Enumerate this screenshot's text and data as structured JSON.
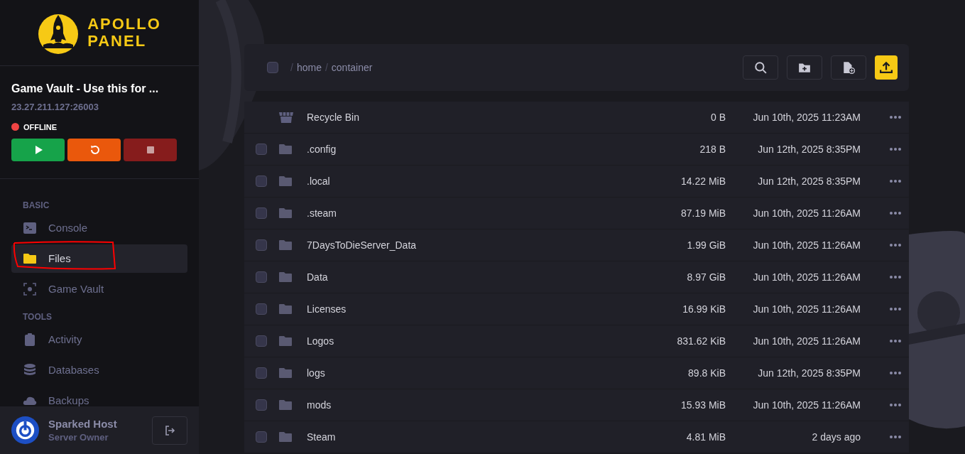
{
  "brand": {
    "line_1": "APOLLO",
    "line_2": "PANEL"
  },
  "server": {
    "name": "Game Vault - Use this for ...",
    "address": "23.27.211.127:26003",
    "status": "OFFLINE",
    "online": false
  },
  "power_buttons": [
    {
      "kind": "start"
    },
    {
      "kind": "restart"
    },
    {
      "kind": "stop"
    }
  ],
  "nav_sections": [
    {
      "title": "BASIC",
      "items": [
        {
          "label": "Console",
          "kind": "terminal",
          "selected": false,
          "annotated": false
        },
        {
          "label": "Files",
          "kind": "folder",
          "selected": true,
          "annotated": true
        },
        {
          "label": "Game Vault",
          "kind": "focus",
          "selected": false,
          "annotated": false
        }
      ]
    },
    {
      "title": "TOOLS",
      "items": [
        {
          "label": "Activity",
          "kind": "clipboard",
          "selected": false,
          "annotated": false
        },
        {
          "label": "Databases",
          "kind": "database",
          "selected": false,
          "annotated": false
        },
        {
          "label": "Backups",
          "kind": "cloud",
          "selected": false,
          "annotated": false
        }
      ]
    }
  ],
  "user": {
    "name": "Sparked Host",
    "role": "Server Owner"
  },
  "select_all_checked": false,
  "breadcrumb": [
    {
      "separator": "/",
      "label": "home"
    },
    {
      "separator": "/",
      "label": "container"
    }
  ],
  "toolbar": [
    {
      "kind": "search"
    },
    {
      "kind": "new-folder"
    },
    {
      "kind": "new-file"
    },
    {
      "kind": "upload"
    }
  ],
  "files": [
    {
      "kind": "recycle",
      "name": "Recycle Bin",
      "size": "0 B",
      "modified": "Jun 10th, 2025 11:23AM"
    },
    {
      "kind": "folder",
      "name": ".config",
      "size": "218 B",
      "modified": "Jun 12th, 2025 8:35PM",
      "checked": false
    },
    {
      "kind": "folder",
      "name": ".local",
      "size": "14.22 MiB",
      "modified": "Jun 12th, 2025 8:35PM",
      "checked": false
    },
    {
      "kind": "folder",
      "name": ".steam",
      "size": "87.19 MiB",
      "modified": "Jun 10th, 2025 11:26AM",
      "checked": false
    },
    {
      "kind": "folder",
      "name": "7DaysToDieServer_Data",
      "size": "1.99 GiB",
      "modified": "Jun 10th, 2025 11:26AM",
      "checked": false
    },
    {
      "kind": "folder",
      "name": "Data",
      "size": "8.97 GiB",
      "modified": "Jun 10th, 2025 11:26AM",
      "checked": false
    },
    {
      "kind": "folder",
      "name": "Licenses",
      "size": "16.99 KiB",
      "modified": "Jun 10th, 2025 11:26AM",
      "checked": false
    },
    {
      "kind": "folder",
      "name": "Logos",
      "size": "831.62 KiB",
      "modified": "Jun 10th, 2025 11:26AM",
      "checked": false
    },
    {
      "kind": "folder",
      "name": "logs",
      "size": "89.8 KiB",
      "modified": "Jun 12th, 2025 8:35PM",
      "checked": false
    },
    {
      "kind": "folder",
      "name": "mods",
      "size": "15.93 MiB",
      "modified": "Jun 10th, 2025 11:26AM",
      "checked": false
    },
    {
      "kind": "folder",
      "name": "Steam",
      "size": "4.81 MiB",
      "modified": "2 days ago",
      "checked": false
    }
  ]
}
